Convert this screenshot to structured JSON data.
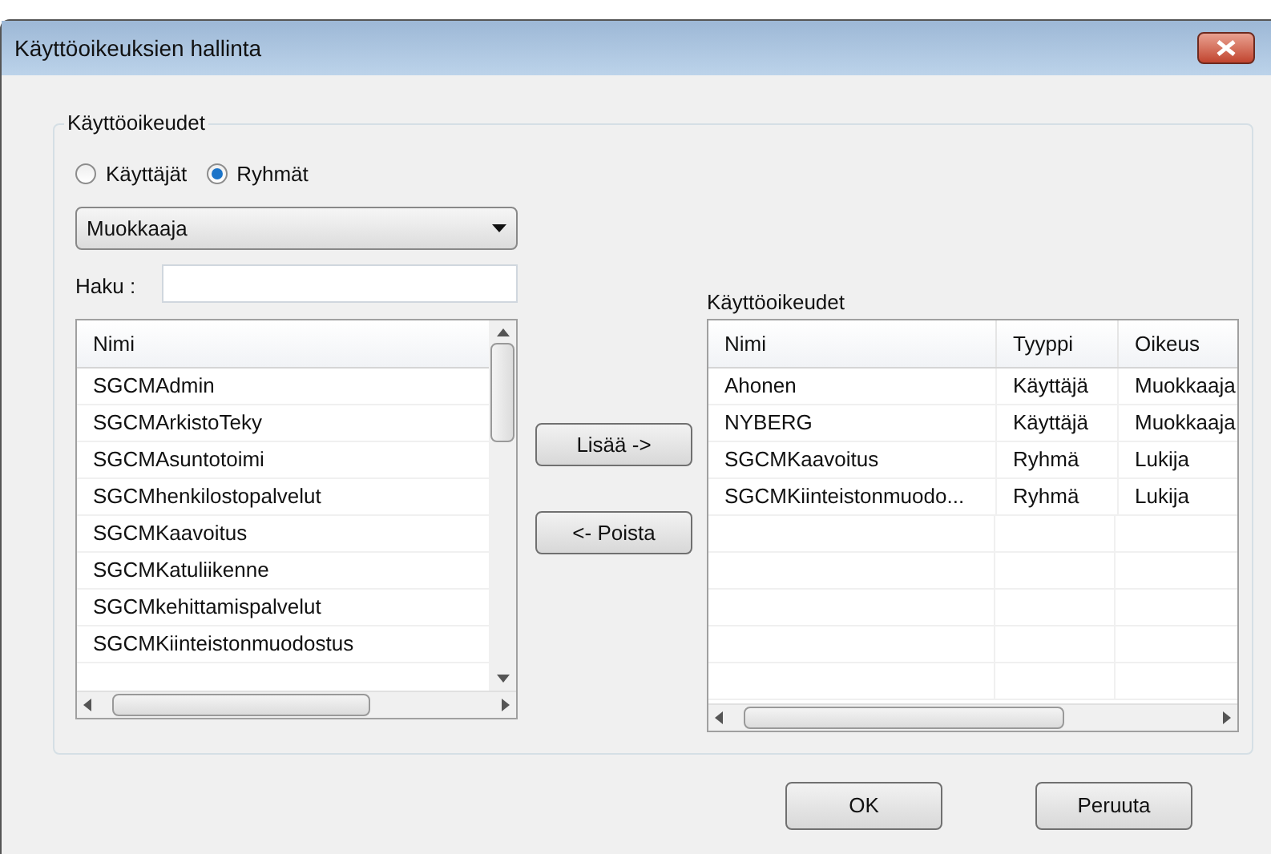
{
  "window": {
    "title": "Käyttöoikeuksien hallinta"
  },
  "group": {
    "title": "Käyttöoikeudet"
  },
  "radios": [
    {
      "label": "Käyttäjät",
      "selected": false
    },
    {
      "label": "Ryhmät",
      "selected": true
    }
  ],
  "dropdown": {
    "value": "Muokkaaja"
  },
  "search": {
    "label": "Haku :"
  },
  "left_list": {
    "columns": [
      "Nimi"
    ],
    "rows": [
      "SGCMAdmin",
      "SGCMArkistoTeky",
      "SGCMAsuntotoimi",
      "SGCMhenkilostopalvelut",
      "SGCMKaavoitus",
      "SGCMKatuliikenne",
      "SGCMkehittamispalvelut",
      "SGCMKiinteistonmuodostus"
    ]
  },
  "move_buttons": [
    "Lisää ->",
    "<- Poista"
  ],
  "right_list": {
    "title": "Käyttöoikeudet",
    "columns": [
      "Nimi",
      "Tyyppi",
      "Oikeus"
    ],
    "rows": [
      [
        "Ahonen",
        "Käyttäjä",
        "Muokkaaja"
      ],
      [
        "NYBERG",
        "Käyttäjä",
        "Muokkaaja"
      ],
      [
        "SGCMKaavoitus",
        "Ryhmä",
        "Lukija"
      ],
      [
        "SGCMKiinteistonmuodo...",
        "Ryhmä",
        "Lukija"
      ]
    ]
  },
  "buttons": [
    "OK",
    "Peruuta"
  ]
}
